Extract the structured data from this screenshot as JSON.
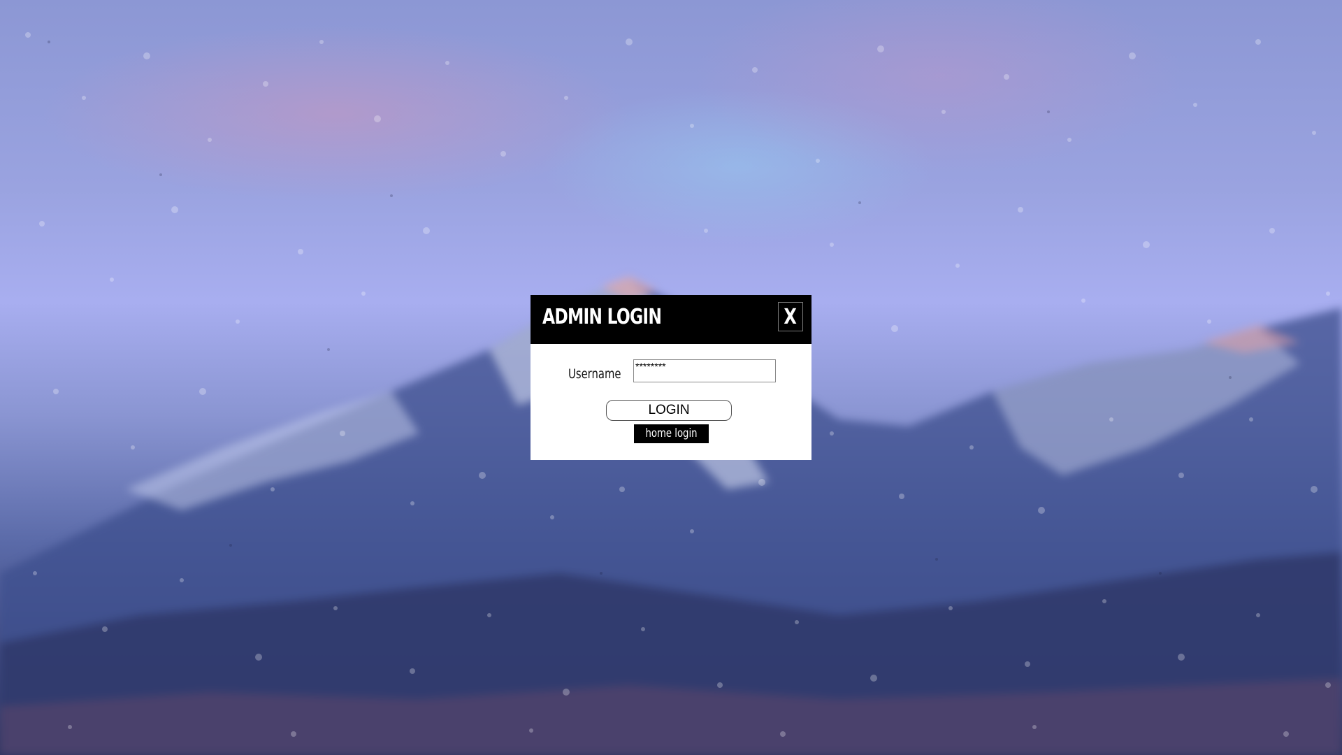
{
  "dialog": {
    "title": "ADMIN LOGIN",
    "close_label": "X",
    "username_label": "Username",
    "username_value": "********",
    "login_button_label": "LOGIN",
    "home_login_label": "home login"
  },
  "background": {
    "description_icon": "rainy-mountain-wallpaper"
  },
  "colors": {
    "header_bg": "#000000",
    "header_text": "#ffffff",
    "dialog_bg": "#ffffff",
    "link_bg": "#000000",
    "link_text": "#ffffff"
  }
}
